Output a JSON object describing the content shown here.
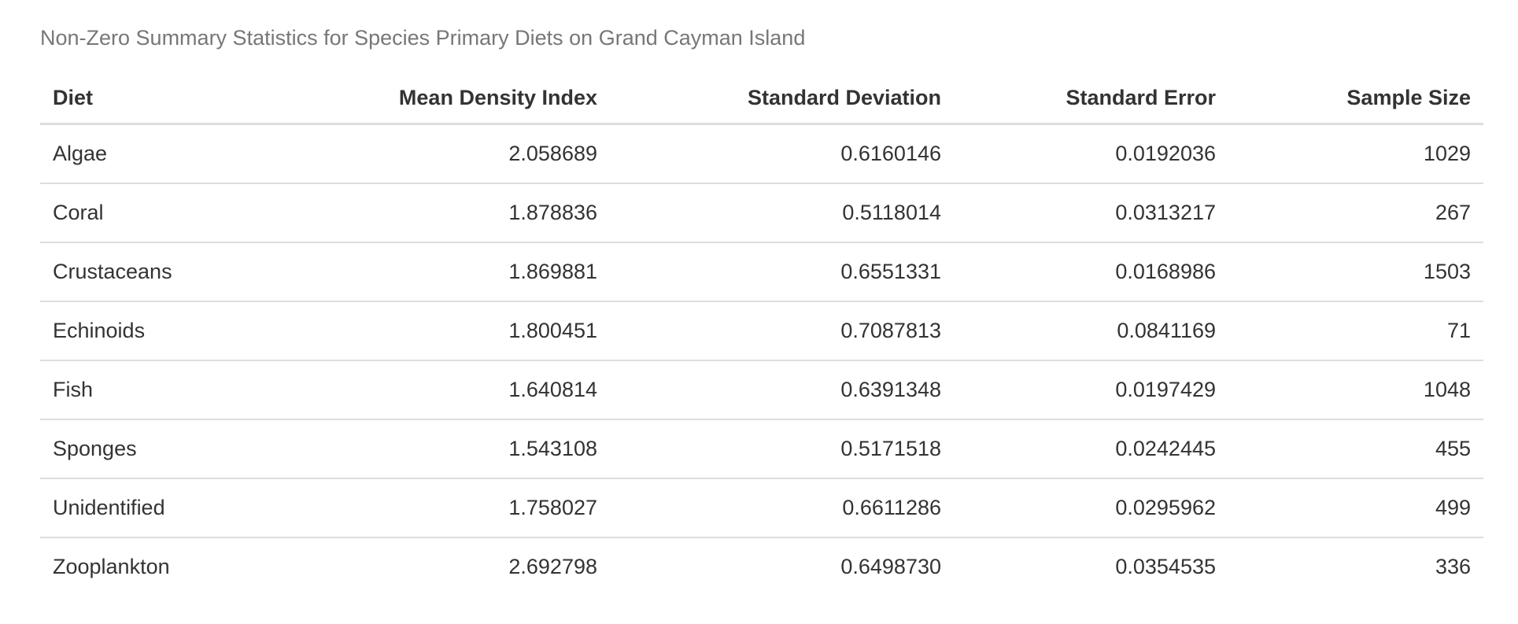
{
  "caption": "Non-Zero Summary Statistics for Species Primary Diets on Grand Cayman Island",
  "headers": [
    "Diet",
    "Mean Density Index",
    "Standard Deviation",
    "Standard Error",
    "Sample Size"
  ],
  "rows": [
    [
      "Algae",
      "2.058689",
      "0.6160146",
      "0.0192036",
      "1029"
    ],
    [
      "Coral",
      "1.878836",
      "0.5118014",
      "0.0313217",
      "267"
    ],
    [
      "Crustaceans",
      "1.869881",
      "0.6551331",
      "0.0168986",
      "1503"
    ],
    [
      "Echinoids",
      "1.800451",
      "0.7087813",
      "0.0841169",
      "71"
    ],
    [
      "Fish",
      "1.640814",
      "0.6391348",
      "0.0197429",
      "1048"
    ],
    [
      "Sponges",
      "1.543108",
      "0.5171518",
      "0.0242445",
      "455"
    ],
    [
      "Unidentified",
      "1.758027",
      "0.6611286",
      "0.0295962",
      "499"
    ],
    [
      "Zooplankton",
      "2.692798",
      "0.6498730",
      "0.0354535",
      "336"
    ]
  ]
}
